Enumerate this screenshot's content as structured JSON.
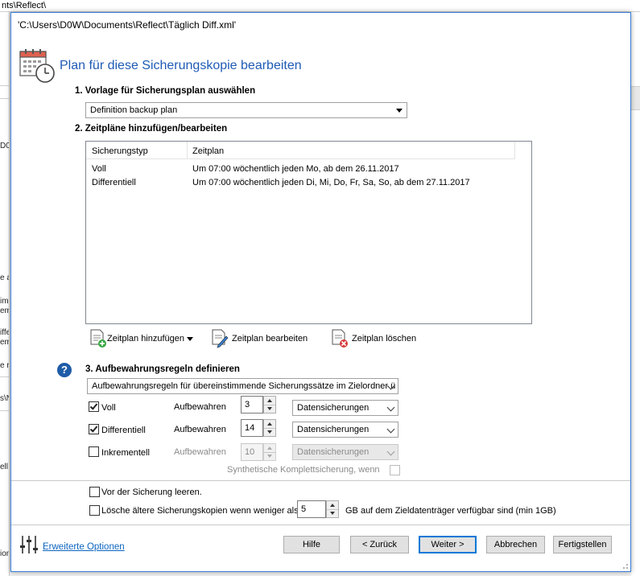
{
  "background_window": {
    "title": "nts\\Reflect\\",
    "left_fragments": [
      "D0W",
      "e a",
      "im",
      "eme",
      "iffe",
      "eme",
      "e n",
      "s\\N",
      "ell",
      "ion"
    ]
  },
  "dialog": {
    "title": "'C:\\Users\\D0W\\Documents\\Reflect\\Täglich Diff.xml'",
    "header": "Plan für diese Sicherungskopie bearbeiten"
  },
  "section1": {
    "label": "1. Vorlage für Sicherungsplan auswählen",
    "selected": "Definition backup plan"
  },
  "section2": {
    "label": "2. Zeitpläne hinzufügen/bearbeiten",
    "columns": [
      "Sicherungstyp",
      "Zeitplan"
    ],
    "rows": [
      {
        "type": "Voll",
        "schedule": "Um 07:00 wöchentlich jeden Mo, ab dem 26.11.2017"
      },
      {
        "type": "Differentiell",
        "schedule": "Um 07:00 wöchentlich jeden Di, Mi, Do, Fr, Sa, So, ab dem 27.11.2017"
      }
    ],
    "add_label": "Zeitplan hinzufügen",
    "edit_label": "Zeitplan bearbeiten",
    "delete_label": "Zeitplan löschen"
  },
  "section3": {
    "label": "3. Aufbewahrungsregeln definieren",
    "rule_selected": "Aufbewahrungsregeln für übereinstimmende Sicherungssätze im Zielordner ü",
    "rows": [
      {
        "label": "Voll",
        "checked": true,
        "keep": "Aufbewahren",
        "value": "3",
        "unit": "Datensicherungen",
        "enabled": true
      },
      {
        "label": "Differentiell",
        "checked": true,
        "keep": "Aufbewahren",
        "value": "14",
        "unit": "Datensicherungen",
        "enabled": true
      },
      {
        "label": "Inkrementell",
        "checked": false,
        "keep": "Aufbewahren",
        "value": "10",
        "unit": "Datensicherungen",
        "enabled": false
      }
    ],
    "synthetic_label": "Synthetische Komplettsicherung, wenn"
  },
  "options": {
    "clear_before": "Vor der Sicherung leeren.",
    "delete_older": "Lösche ältere Sicherungskopien wenn weniger als",
    "gb_value": "5",
    "gb_suffix": "GB auf dem Zieldatenträger verfügbar sind (min 1GB)"
  },
  "footer": {
    "advanced_link": "Erweiterte Optionen",
    "help": "Hilfe",
    "back": "< Zurück",
    "next": "Weiter >",
    "cancel": "Abbrechen",
    "finish": "Fertigstellen"
  },
  "colors": {
    "accent": "#1f5bb5",
    "link": "#0b64c0",
    "dialog_border": "#3a7dd6",
    "help_icon": "#1e5ca8"
  }
}
